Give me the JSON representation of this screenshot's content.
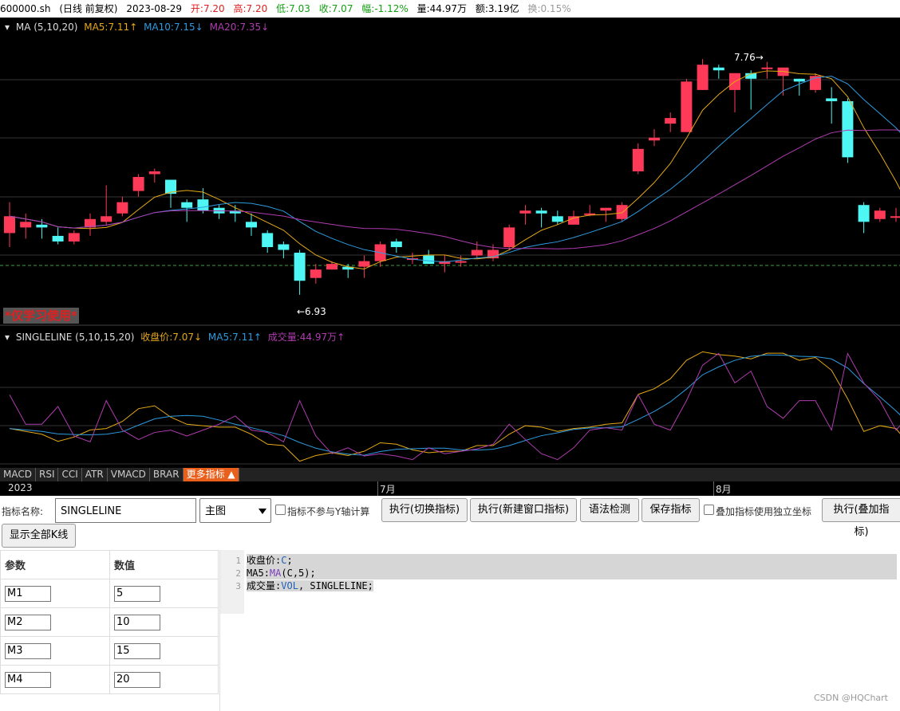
{
  "header": {
    "symbol": "600000.sh",
    "period": "(日线 前复权)",
    "date": "2023-08-29",
    "open": "开:7.20",
    "high": "高:7.20",
    "low": "低:7.03",
    "close": "收:7.07",
    "change": "幅:-1.12%",
    "volume": "量:44.97万",
    "amount": "额:3.19亿",
    "turnover": "换:0.15%"
  },
  "ma_indicator": {
    "name": "MA (5,10,20)",
    "ma5": "MA5:7.11↑",
    "ma10": "MA10:7.15↓",
    "ma20": "MA20:7.35↓"
  },
  "singleline_indicator": {
    "name": "SINGLELINE (5,10,15,20)",
    "close": "收盘价:7.07↓",
    "ma5": "MA5:7.11↑",
    "vol": "成交量:44.97万↑"
  },
  "annotations": {
    "high": "7.76→",
    "low": "←6.93"
  },
  "watermark": "*仅学习使用*",
  "tabs": [
    "MACD",
    "RSI",
    "CCI",
    "ATR",
    "VMACD",
    "BRAR",
    "更多指标 ▲"
  ],
  "xaxis": {
    "labels": [
      "2023",
      "7月",
      "8月"
    ]
  },
  "colors": {
    "up": "#ff3a58",
    "down": "#4ef6f4",
    "ma5": "#e6a817",
    "ma10": "#2e9be0",
    "ma20": "#b03cb0"
  },
  "form": {
    "name_label": "指标名称:",
    "name_value": "SINGLELINE",
    "chart_select": "主图",
    "no_yaxis_label": "指标不参与Y轴计算",
    "btn_switch": "执行(切换指标)",
    "btn_new_window": "执行(新建窗口指标)",
    "btn_syntax": "语法检测",
    "btn_save": "保存指标",
    "overlay_label": "叠加指标使用独立坐标",
    "btn_overlay": "执行(叠加指标)",
    "btn_show_all": "显示全部K线"
  },
  "params": {
    "header_name": "参数",
    "header_value": "数值",
    "rows": [
      {
        "name": "M1",
        "value": "5"
      },
      {
        "name": "M2",
        "value": "10"
      },
      {
        "name": "M3",
        "value": "15"
      },
      {
        "name": "M4",
        "value": "20"
      }
    ]
  },
  "code": {
    "line_numbers": [
      "1",
      "2",
      "3"
    ],
    "line1": {
      "name": "收盘价",
      "colon": ":",
      "expr": "C",
      "end": ";"
    },
    "line2": {
      "name": "MA5",
      "colon": ":",
      "fn": "MA",
      "args": "(C,5)",
      "end": ";"
    },
    "line3": {
      "name": "成交量",
      "colon": ":",
      "expr": "VOL",
      "rest": ", SINGLELINE;"
    }
  },
  "credit": "CSDN @HQChart",
  "chart_data": {
    "type": "candlestick",
    "y_range": [
      6.85,
      7.85
    ],
    "candles": [
      [
        7.15,
        7.21,
        7.1,
        7.26
      ],
      [
        7.17,
        7.19,
        7.13,
        7.22
      ],
      [
        7.18,
        7.17,
        7.13,
        7.2
      ],
      [
        7.14,
        7.12,
        7.11,
        7.17
      ],
      [
        7.12,
        7.15,
        7.11,
        7.16
      ],
      [
        7.17,
        7.2,
        7.14,
        7.22
      ],
      [
        7.19,
        7.21,
        7.18,
        7.32
      ],
      [
        7.22,
        7.26,
        7.21,
        7.28
      ],
      [
        7.3,
        7.35,
        7.28,
        7.36
      ],
      [
        7.36,
        7.37,
        7.33,
        7.38
      ],
      [
        7.34,
        7.29,
        7.24,
        7.34
      ],
      [
        7.26,
        7.24,
        7.19,
        7.27
      ],
      [
        7.27,
        7.23,
        7.22,
        7.31
      ],
      [
        7.24,
        7.22,
        7.2,
        7.25
      ],
      [
        7.23,
        7.22,
        7.19,
        7.25
      ],
      [
        7.19,
        7.17,
        7.14,
        7.22
      ],
      [
        7.15,
        7.1,
        7.08,
        7.16
      ],
      [
        7.11,
        7.09,
        7.06,
        7.12
      ],
      [
        7.08,
        6.98,
        6.93,
        7.09
      ],
      [
        6.99,
        7.02,
        6.97,
        7.04
      ],
      [
        7.02,
        7.04,
        7.02,
        7.05
      ],
      [
        7.03,
        7.02,
        6.99,
        7.04
      ],
      [
        7.03,
        7.05,
        6.99,
        7.07
      ],
      [
        7.05,
        7.11,
        7.03,
        7.12
      ],
      [
        7.12,
        7.1,
        7.08,
        7.13
      ],
      [
        7.06,
        7.06,
        7.04,
        7.08
      ],
      [
        7.07,
        7.04,
        7.04,
        7.09
      ],
      [
        7.04,
        7.05,
        7.01,
        7.07
      ],
      [
        7.05,
        7.05,
        7.03,
        7.07
      ],
      [
        7.07,
        7.09,
        7.06,
        7.12
      ],
      [
        7.06,
        7.09,
        7.05,
        7.11
      ],
      [
        7.1,
        7.17,
        7.09,
        7.18
      ],
      [
        7.22,
        7.23,
        7.18,
        7.25
      ],
      [
        7.23,
        7.22,
        7.17,
        7.24
      ],
      [
        7.21,
        7.19,
        7.18,
        7.23
      ],
      [
        7.18,
        7.21,
        7.18,
        7.23
      ],
      [
        7.22,
        7.22,
        7.21,
        7.25
      ],
      [
        7.23,
        7.24,
        7.19,
        7.24
      ],
      [
        7.2,
        7.25,
        7.19,
        7.26
      ],
      [
        7.37,
        7.45,
        7.36,
        7.47
      ],
      [
        7.48,
        7.49,
        7.46,
        7.52
      ],
      [
        7.54,
        7.56,
        7.51,
        7.58
      ],
      [
        7.51,
        7.69,
        7.51,
        7.7
      ],
      [
        7.66,
        7.75,
        7.66,
        7.77
      ],
      [
        7.74,
        7.73,
        7.7,
        7.75
      ],
      [
        7.66,
        7.72,
        7.58,
        7.72
      ],
      [
        7.72,
        7.7,
        7.59,
        7.73
      ],
      [
        7.74,
        7.74,
        7.7,
        7.76
      ],
      [
        7.71,
        7.74,
        7.64,
        7.74
      ],
      [
        7.7,
        7.69,
        7.64,
        7.7
      ],
      [
        7.66,
        7.71,
        7.65,
        7.72
      ],
      [
        7.63,
        7.62,
        7.54,
        7.67
      ],
      [
        7.62,
        7.42,
        7.4,
        7.63
      ],
      [
        7.25,
        7.19,
        7.15,
        7.26
      ],
      [
        7.2,
        7.23,
        7.19,
        7.24
      ],
      [
        7.21,
        7.21,
        7.19,
        7.24
      ],
      [
        7.2,
        7.07,
        7.03,
        7.2
      ]
    ]
  }
}
